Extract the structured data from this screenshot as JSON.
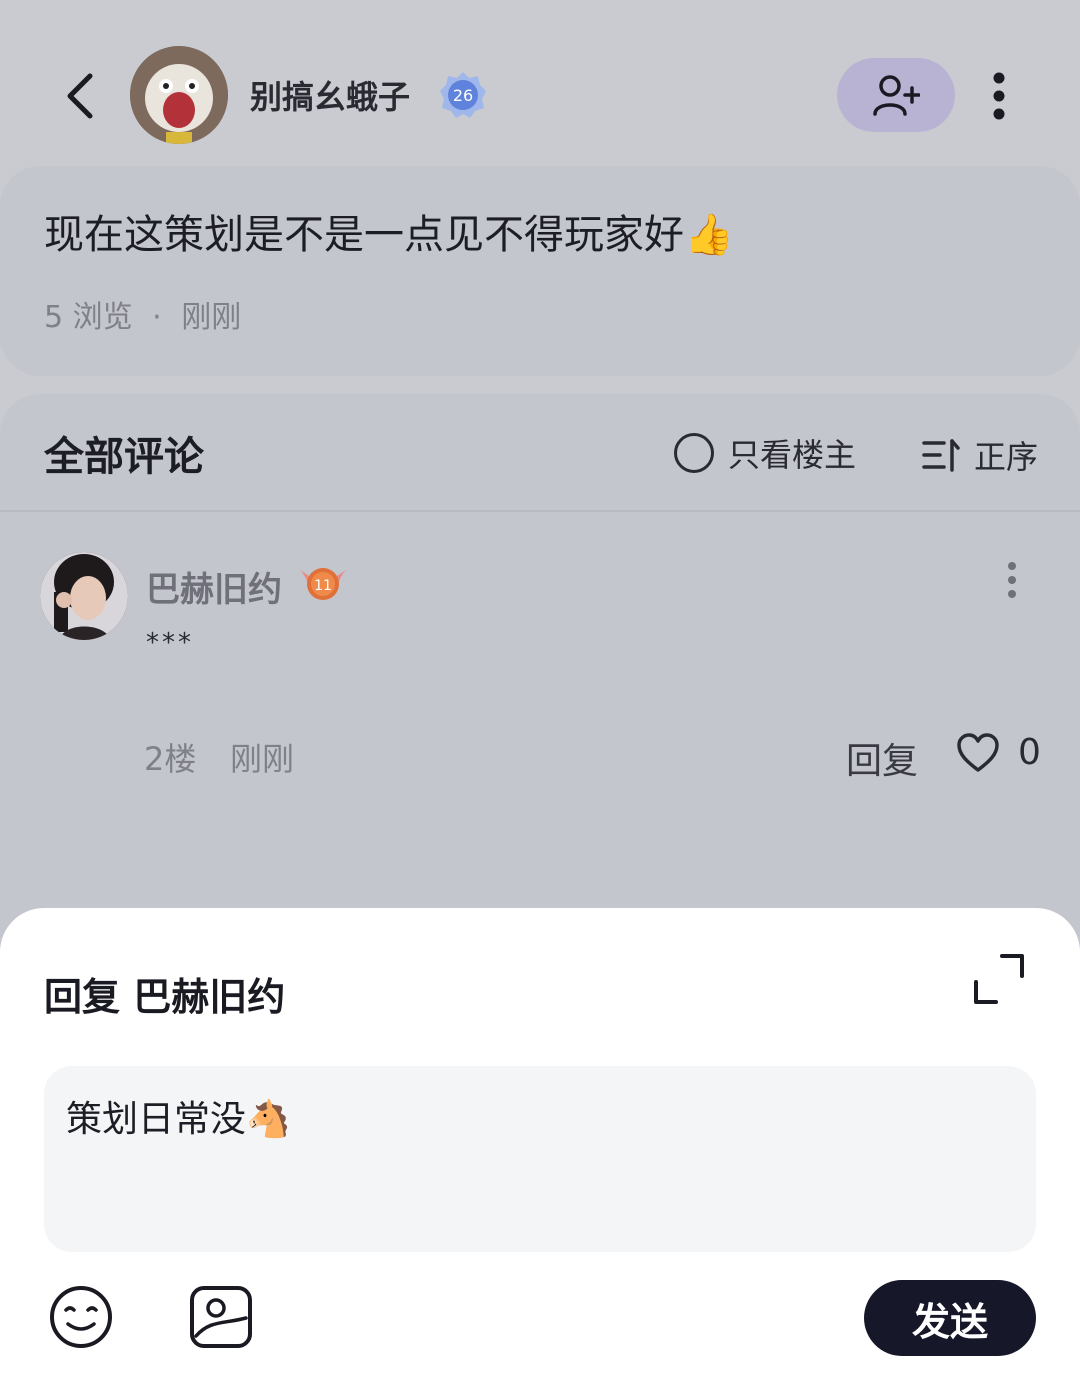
{
  "header": {
    "username": "别搞幺蛾子",
    "level": "26",
    "icons": {
      "back": "chevron-left-icon",
      "follow": "user-plus-icon",
      "more": "more-vertical-icon"
    }
  },
  "post": {
    "text": "现在这策划是不是一点见不得玩家好👍",
    "views": "5 浏览",
    "separator": "·",
    "time": "刚刚"
  },
  "comments": {
    "title": "全部评论",
    "owner_only_label": "只看楼主",
    "sort_label": "正序",
    "items": [
      {
        "name": "巴赫旧约",
        "level": "11",
        "text": "***",
        "floor": "2楼",
        "time": "刚刚",
        "reply_label": "回复",
        "likes": "0"
      }
    ]
  },
  "reply_sheet": {
    "title": "回复 巴赫旧约",
    "input_value": "策划日常没🐴",
    "send_label": "发送",
    "icons": {
      "expand": "expand-icon",
      "emoji": "emoji-icon",
      "image": "image-icon"
    }
  },
  "colors": {
    "background_dim": "#c9cbd1",
    "follow_button": "#b9b3d3",
    "send_button": "#17172a",
    "level_badge": "#6f8fe0",
    "comment_badge": "#e0703a"
  }
}
